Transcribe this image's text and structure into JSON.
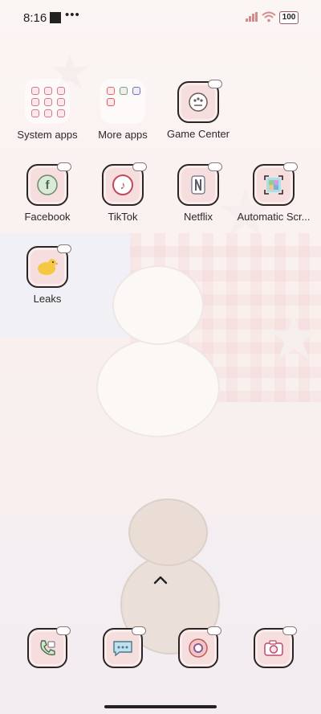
{
  "status_bar": {
    "time": "8:16",
    "battery": "100"
  },
  "apps": {
    "system_apps": "System apps",
    "more_apps": "More apps",
    "game_center": "Game Center",
    "facebook": "Facebook",
    "tiktok": "TikTok",
    "netflix": "Netflix",
    "automatic_scr": "Automatic Scr...",
    "leaks": "Leaks"
  },
  "dock": [
    "phone-icon",
    "messages-icon",
    "chrome-icon",
    "camera-icon"
  ],
  "colors": {
    "icon_bg": "#f7dede",
    "icon_border": "#2c2526",
    "accent": "#d77a88"
  }
}
